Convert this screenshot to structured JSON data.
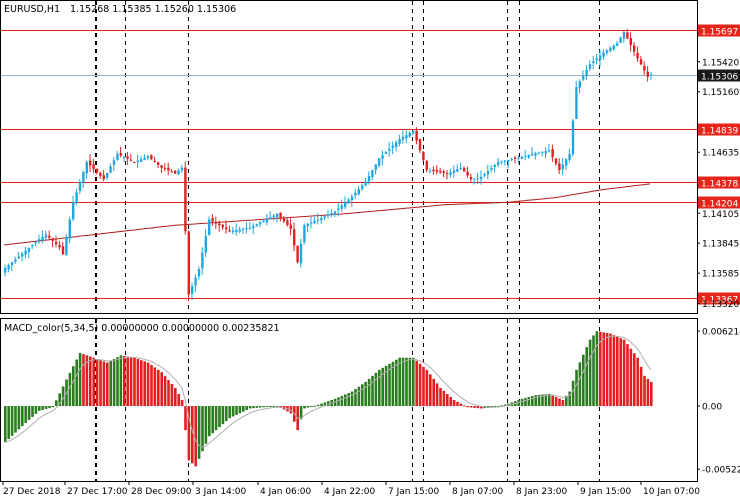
{
  "header": {
    "symbol": "EURUSD,H1",
    "ohlc": "1.15268 1.15385 1.15260 1.15306"
  },
  "macd_header": {
    "label": "MACD_color(5,34,5) 0.00000000 0.00000000 0.00235821"
  },
  "colors": {
    "bull": "#1fa8e0",
    "bear": "#e02020",
    "level_line": "#e0201a",
    "ma_line": "#b01c1c",
    "current_price_line": "#9ab3c8",
    "hist_up": "#2a7d1e",
    "hist_down": "#e02020",
    "signal_line": "#b0b0b0",
    "price_tag_bg": "#e8231a",
    "current_tag_bg": "#1a1a1a"
  },
  "price_axis_ticks": [
    "1.15420",
    "1.15160",
    "1.14635",
    "1.14105",
    "1.13845",
    "1.13585",
    "1.13320"
  ],
  "macd_axis_ticks": [
    "0.0062145",
    "0.00",
    "-0.005228"
  ],
  "time_axis_ticks": [
    "27 Dec 2018",
    "27 Dec 17:00",
    "28 Dec 09:00",
    "3 Jan 14:00",
    "4 Jan 06:00",
    "4 Jan 22:00",
    "7 Jan 15:00",
    "8 Jan 07:00",
    "8 Jan 23:00",
    "9 Jan 15:00",
    "10 Jan 07:00"
  ],
  "levels": [
    {
      "label": "1.15697",
      "value": 1.15697
    },
    {
      "label": "1.14839",
      "value": 1.14839
    },
    {
      "label": "1.14378",
      "value": 1.14378
    },
    {
      "label": "1.14204",
      "value": 1.14204
    },
    {
      "label": "1.13367",
      "value": 1.13367
    }
  ],
  "current_price": {
    "label": "1.15306",
    "value": 1.15306
  },
  "chart_data": [
    {
      "type": "candlestick",
      "symbol": "EURUSD",
      "timeframe": "H1",
      "y_range": [
        1.133,
        1.158
      ],
      "anchor_closes": [
        [
          0,
          1.1363
        ],
        [
          10,
          1.1388
        ],
        [
          12,
          1.1392
        ],
        [
          16,
          1.1381
        ],
        [
          17,
          1.1375
        ],
        [
          20,
          1.142
        ],
        [
          24,
          1.1455
        ],
        [
          29,
          1.144
        ],
        [
          33,
          1.1462
        ],
        [
          38,
          1.1455
        ],
        [
          42,
          1.146
        ],
        [
          46,
          1.145
        ],
        [
          50,
          1.1445
        ],
        [
          52,
          1.145
        ],
        [
          54,
          1.134
        ],
        [
          57,
          1.1362
        ],
        [
          60,
          1.1405
        ],
        [
          66,
          1.1395
        ],
        [
          72,
          1.1398
        ],
        [
          80,
          1.141
        ],
        [
          84,
          1.1397
        ],
        [
          86,
          1.1368
        ],
        [
          88,
          1.14
        ],
        [
          92,
          1.1405
        ],
        [
          97,
          1.1412
        ],
        [
          102,
          1.1425
        ],
        [
          106,
          1.1438
        ],
        [
          110,
          1.1458
        ],
        [
          116,
          1.1475
        ],
        [
          120,
          1.1482
        ],
        [
          124,
          1.1448
        ],
        [
          130,
          1.1445
        ],
        [
          134,
          1.145
        ],
        [
          137,
          1.144
        ],
        [
          140,
          1.1442
        ],
        [
          145,
          1.1455
        ],
        [
          150,
          1.1458
        ],
        [
          155,
          1.1462
        ],
        [
          160,
          1.1465
        ],
        [
          163,
          1.1448
        ],
        [
          166,
          1.1462
        ],
        [
          168,
          1.152
        ],
        [
          172,
          1.154
        ],
        [
          176,
          1.155
        ],
        [
          180,
          1.1558
        ],
        [
          182,
          1.1568
        ],
        [
          186,
          1.1545
        ],
        [
          189,
          1.1529
        ],
        [
          190,
          1.1531
        ]
      ],
      "moving_average_anchors": [
        [
          0,
          1.1383
        ],
        [
          50,
          1.14
        ],
        [
          100,
          1.141
        ],
        [
          130,
          1.1418
        ],
        [
          148,
          1.142
        ],
        [
          162,
          1.1424
        ],
        [
          176,
          1.1431
        ],
        [
          190,
          1.1436
        ]
      ],
      "levels": [
        1.15697,
        1.14839,
        1.14378,
        1.14204,
        1.13367
      ],
      "current_price": 1.15306
    },
    {
      "type": "histogram",
      "indicator": "MACD_color(5,34,5)",
      "y_range": [
        -0.0053,
        0.0063
      ],
      "anchor_values": [
        [
          0,
          -0.003
        ],
        [
          6,
          -0.0014
        ],
        [
          10,
          -0.0004
        ],
        [
          14,
          -0.0001
        ],
        [
          18,
          0.0022
        ],
        [
          22,
          0.0044
        ],
        [
          26,
          0.004
        ],
        [
          30,
          0.0036
        ],
        [
          34,
          0.0042
        ],
        [
          38,
          0.004
        ],
        [
          42,
          0.0036
        ],
        [
          46,
          0.0028
        ],
        [
          50,
          0.0015
        ],
        [
          52,
          0.0005
        ],
        [
          54,
          -0.0045
        ],
        [
          56,
          -0.005
        ],
        [
          60,
          -0.0025
        ],
        [
          66,
          -0.001
        ],
        [
          72,
          -0.0002
        ],
        [
          80,
          0.0
        ],
        [
          84,
          -0.0006
        ],
        [
          86,
          -0.002
        ],
        [
          88,
          -0.0002
        ],
        [
          92,
          0.0001
        ],
        [
          97,
          0.0006
        ],
        [
          102,
          0.0012
        ],
        [
          106,
          0.002
        ],
        [
          110,
          0.003
        ],
        [
          116,
          0.004
        ],
        [
          120,
          0.004
        ],
        [
          124,
          0.003
        ],
        [
          128,
          0.0015
        ],
        [
          132,
          0.0005
        ],
        [
          136,
          -0.0001
        ],
        [
          140,
          -0.0002
        ],
        [
          144,
          -0.0001
        ],
        [
          148,
          0.0002
        ],
        [
          152,
          0.0006
        ],
        [
          156,
          0.0009
        ],
        [
          160,
          0.001
        ],
        [
          164,
          0.0005
        ],
        [
          166,
          0.0012
        ],
        [
          168,
          0.003
        ],
        [
          172,
          0.0055
        ],
        [
          174,
          0.0062
        ],
        [
          178,
          0.006
        ],
        [
          182,
          0.0055
        ],
        [
          186,
          0.004
        ],
        [
          188,
          0.0025
        ],
        [
          190,
          0.002
        ]
      ],
      "signal_note": "signal line drawn over histogram"
    }
  ]
}
